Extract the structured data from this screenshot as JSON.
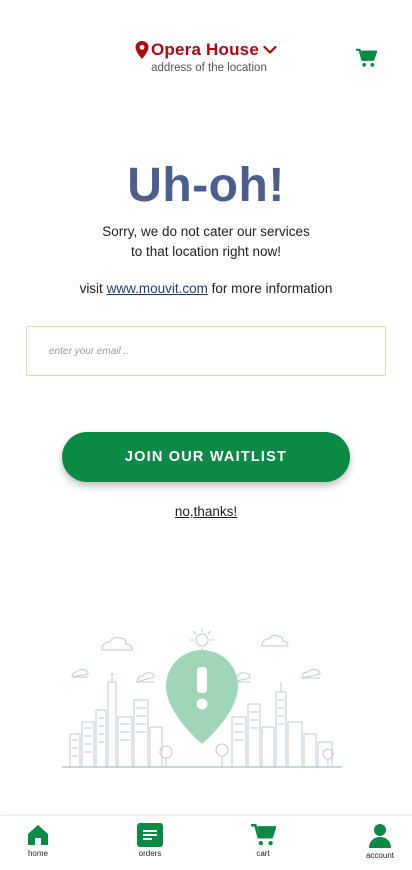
{
  "header": {
    "location_name": "Opera House",
    "location_sub": "address of the location",
    "accent_color": "#b3060d",
    "icons": [
      "location-pin-icon",
      "chevron-down-icon",
      "cart-icon"
    ]
  },
  "main": {
    "title": "Uh-oh!",
    "message_line1": "Sorry, we do not cater our services",
    "message_line2": "to that location right now!",
    "visit_prefix": "visit",
    "visit_link": "www.mouvit.com",
    "visit_suffix": "for more information",
    "email_placeholder": "enter your email ..",
    "join_label": "JOIN OUR WAITLIST",
    "no_thanks": "no,thanks!",
    "title_color": "#4a5f8e",
    "button_color": "#0a8a45"
  },
  "nav": {
    "items": [
      {
        "label": "home",
        "icon": "home-icon"
      },
      {
        "label": "orders",
        "icon": "orders-icon"
      },
      {
        "label": "cart",
        "icon": "cart-icon"
      },
      {
        "label": "account",
        "icon": "account-icon"
      }
    ],
    "active_color": "#0a8a45"
  }
}
